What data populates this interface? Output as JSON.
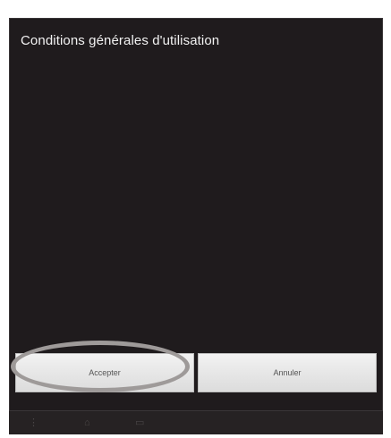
{
  "dialog": {
    "title": "Conditions générales d'utilisation"
  },
  "buttons": {
    "accept_label": "Accepter",
    "cancel_label": "Annuler"
  },
  "nav": {
    "icons": [
      "menu-icon",
      "home-icon",
      "recent-apps-icon"
    ]
  },
  "colors": {
    "dialog_background": "#1f1b1d",
    "title_text": "#f2f2f2",
    "button_background": "#e8e8e8",
    "highlight_ring": "#9e9a99",
    "nav_background": "#262223"
  }
}
